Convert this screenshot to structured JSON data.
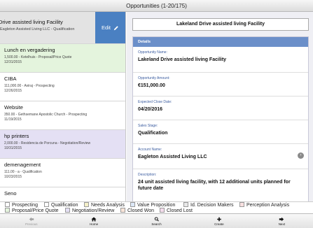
{
  "header": {
    "title": "Opportunities (1-20/175)"
  },
  "list": {
    "selected": {
      "name": "Drive assisted living Facility",
      "line1": "Eagleton Assisted Living LLC - Qualification",
      "edit_label": "Edit"
    },
    "items": [
      {
        "name": "Lunch en vergadering",
        "line1": "1,500.00 - Ketelhuis - Proposal/Price Quote",
        "line2": "12/31/2015"
      },
      {
        "name": "CIBA",
        "line1": "111,000.00 - Aviraj - Prospecting",
        "line2": "12/26/2015"
      },
      {
        "name": "Website",
        "line1": "350.00 - Gethsemane Apostolic Church - Prospecting",
        "line2": "11/19/2015"
      },
      {
        "name": "hp printers",
        "line1": "2,000.00 - Residencia de Porcuna - Negotiation/Review",
        "line2": "10/31/2015"
      },
      {
        "name": "demenagement",
        "line1": "111.00 - a - Qualification",
        "line2": "10/23/2015"
      },
      {
        "name": "Seno"
      }
    ]
  },
  "detail": {
    "title": "Lakeland Drive assisted living Facility",
    "section": "Details",
    "fields": {
      "name": {
        "label": "Opportunity Name:",
        "value": "Lakeland Drive assisted living Facility"
      },
      "amount": {
        "label": "Opportunity Amount:",
        "value": "€151,000.00"
      },
      "close": {
        "label": "Expected Close Date:",
        "value": "04/20/2016"
      },
      "stage": {
        "label": "Sales Stage:",
        "value": "Qualification"
      },
      "account": {
        "label": "Account Name:",
        "value": "Eagleton Assisted Living LLC"
      },
      "description": {
        "label": "Description:",
        "value": "24 unit assisted living facility, with 12 additional units planned for future date"
      }
    }
  },
  "legend": [
    {
      "label": "Prospecting",
      "color": "#ffffff"
    },
    {
      "label": "Qualification",
      "color": "#ffffff"
    },
    {
      "label": "Needs Analysis",
      "color": "#f4f0c8"
    },
    {
      "label": "Value Proposition",
      "color": "#dce8f8"
    },
    {
      "label": "Id. Decision Makers",
      "color": "#e8e8e8"
    },
    {
      "label": "Perception Analysis",
      "color": "#f8e0e0"
    },
    {
      "label": "Proposal/Price Quote",
      "color": "#e4f4dd"
    },
    {
      "label": "Negotiation/Review",
      "color": "#e4e0f4"
    },
    {
      "label": "Closed Won",
      "color": "#f8e4d8"
    },
    {
      "label": "Closed Lost",
      "color": "#f4dcec"
    }
  ],
  "toolbar": {
    "previous": "Previous",
    "home": "Home",
    "search": "Search",
    "create": "Create",
    "next": "Next"
  }
}
